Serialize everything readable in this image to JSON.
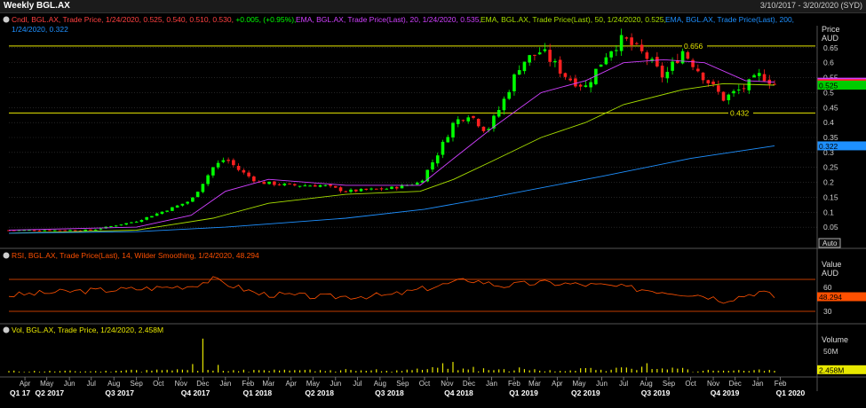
{
  "window": {
    "title": "Weekly BGL.AX",
    "date_range": "3/10/2017 - 3/20/2020 (SYD)"
  },
  "colors": {
    "up": "#00ff00",
    "down": "#ff2020",
    "ema20": "#d040ff",
    "ema50": "#a8e000",
    "ema200": "#1e90ff",
    "hline": "#e8e800",
    "rsi": "#ff5000",
    "vol": "#e8e800",
    "grid": "#3a3a3a",
    "text": "#d0d0d0"
  },
  "legend": {
    "candle_prefix": "Cndl, BGL.AX, Trade Price,  1/24/2020, 0.525, 0.540, 0.510, 0.530, ",
    "candle_change": "+0.005, (+0.95%),",
    "ema20": "EMA, BGL.AX, Trade Price(Last),  20,  1/24/2020, 0.535,",
    "ema50": "EMA, BGL.AX, Trade Price(Last),  50,  1/24/2020, 0.525,",
    "ema200a": "EMA, BGL.AX, Trade Price(Last),  200,",
    "ema200b": "1/24/2020, 0.322",
    "rsi": "RSI, BGL.AX, Trade Price(Last),  14,  Wilder Smoothing,  1/24/2020, 48.294",
    "vol": "Vol, BGL.AX, Trade Price,  1/24/2020,  2.458M"
  },
  "axes": {
    "price_title": "Price",
    "price_unit": "AUD",
    "value_title": "Value",
    "value_unit": "AUD",
    "volume_title": "Volume",
    "auto": "Auto"
  },
  "chart_data": {
    "type": "candlestick",
    "price": {
      "ylim": [
        0,
        0.7
      ],
      "ticks": [
        "0.05",
        "0.1",
        "0.15",
        "0.2",
        "0.25",
        "0.3",
        "0.35",
        "0.4",
        "0.45",
        "0.5",
        "0.55",
        "0.6",
        "0.65"
      ],
      "hlines": [
        {
          "value": 0.656,
          "label": "0.656"
        },
        {
          "value": 0.432,
          "label": "0.432"
        }
      ],
      "tags": [
        {
          "label": "0.535",
          "value": 0.535,
          "color": "#d040ff"
        },
        {
          "label": "0.530",
          "value": 0.53,
          "color": "#ff2020"
        },
        {
          "label": "0.525",
          "value": 0.525,
          "color": "#00cc00"
        },
        {
          "label": "0.322",
          "value": 0.322,
          "color": "#1e90ff"
        }
      ],
      "keypoints": [
        [
          "2017-03-10",
          0.04
        ],
        [
          "2017-07-01",
          0.04
        ],
        [
          "2017-09-01",
          0.07
        ],
        [
          "2017-10-15",
          0.11
        ],
        [
          "2017-11-15",
          0.14
        ],
        [
          "2017-12-15",
          0.25
        ],
        [
          "2018-01-01",
          0.28
        ],
        [
          "2018-01-20",
          0.24
        ],
        [
          "2018-02-15",
          0.2
        ],
        [
          "2018-04-01",
          0.19
        ],
        [
          "2018-05-15",
          0.19
        ],
        [
          "2018-06-15",
          0.17
        ],
        [
          "2018-08-15",
          0.18
        ],
        [
          "2018-09-25",
          0.2
        ],
        [
          "2018-10-20",
          0.3
        ],
        [
          "2018-11-10",
          0.4
        ],
        [
          "2018-12-01",
          0.43
        ],
        [
          "2018-12-25",
          0.37
        ],
        [
          "2019-01-15",
          0.46
        ],
        [
          "2019-02-10",
          0.6
        ],
        [
          "2019-03-10",
          0.64
        ],
        [
          "2019-04-15",
          0.55
        ],
        [
          "2019-05-10",
          0.52
        ],
        [
          "2019-06-10",
          0.64
        ],
        [
          "2019-07-01",
          0.68
        ],
        [
          "2019-08-01",
          0.62
        ],
        [
          "2019-08-25",
          0.55
        ],
        [
          "2019-09-20",
          0.64
        ],
        [
          "2019-10-20",
          0.55
        ],
        [
          "2019-11-15",
          0.48
        ],
        [
          "2019-12-15",
          0.52
        ],
        [
          "2020-01-05",
          0.56
        ],
        [
          "2020-01-24",
          0.53
        ]
      ]
    },
    "ema": [
      {
        "name": "EMA 20",
        "color": "#d040ff",
        "points": [
          [
            "2017-03-10",
            0.04
          ],
          [
            "2017-09-01",
            0.05
          ],
          [
            "2017-11-15",
            0.09
          ],
          [
            "2018-01-01",
            0.17
          ],
          [
            "2018-03-01",
            0.21
          ],
          [
            "2018-06-15",
            0.19
          ],
          [
            "2018-09-25",
            0.19
          ],
          [
            "2018-11-10",
            0.28
          ],
          [
            "2019-01-01",
            0.38
          ],
          [
            "2019-03-10",
            0.5
          ],
          [
            "2019-05-10",
            0.54
          ],
          [
            "2019-07-01",
            0.6
          ],
          [
            "2019-08-25",
            0.61
          ],
          [
            "2019-10-20",
            0.6
          ],
          [
            "2019-12-15",
            0.54
          ],
          [
            "2020-01-24",
            0.535
          ]
        ]
      },
      {
        "name": "EMA 50",
        "color": "#a8e000",
        "points": [
          [
            "2017-03-10",
            0.03
          ],
          [
            "2017-09-01",
            0.04
          ],
          [
            "2017-12-15",
            0.08
          ],
          [
            "2018-03-01",
            0.13
          ],
          [
            "2018-06-15",
            0.16
          ],
          [
            "2018-09-25",
            0.17
          ],
          [
            "2018-11-10",
            0.21
          ],
          [
            "2019-01-01",
            0.27
          ],
          [
            "2019-03-10",
            0.35
          ],
          [
            "2019-05-10",
            0.4
          ],
          [
            "2019-07-01",
            0.46
          ],
          [
            "2019-09-20",
            0.51
          ],
          [
            "2019-11-15",
            0.53
          ],
          [
            "2020-01-24",
            0.525
          ]
        ]
      },
      {
        "name": "EMA 200",
        "color": "#1e90ff",
        "points": [
          [
            "2017-03-10",
            0.03
          ],
          [
            "2017-09-01",
            0.035
          ],
          [
            "2018-01-01",
            0.05
          ],
          [
            "2018-06-15",
            0.08
          ],
          [
            "2018-10-01",
            0.11
          ],
          [
            "2019-01-01",
            0.15
          ],
          [
            "2019-06-01",
            0.22
          ],
          [
            "2019-10-01",
            0.28
          ],
          [
            "2020-01-24",
            0.322
          ]
        ]
      }
    ],
    "rsi": {
      "levels": [
        70,
        30
      ],
      "ticks": [
        "60",
        "30"
      ],
      "last": "48.294",
      "ylim": [
        20,
        90
      ],
      "keypoints": [
        [
          "2017-03-10",
          50
        ],
        [
          "2017-06-01",
          55
        ],
        [
          "2017-09-01",
          58
        ],
        [
          "2017-11-15",
          62
        ],
        [
          "2017-12-15",
          70
        ],
        [
          "2018-02-15",
          52
        ],
        [
          "2018-05-15",
          48
        ],
        [
          "2018-08-15",
          50
        ],
        [
          "2018-10-20",
          62
        ],
        [
          "2018-12-01",
          70
        ],
        [
          "2019-01-15",
          62
        ],
        [
          "2019-03-10",
          66
        ],
        [
          "2019-06-10",
          62
        ],
        [
          "2019-08-25",
          55
        ],
        [
          "2019-10-20",
          50
        ],
        [
          "2019-11-15",
          44
        ],
        [
          "2020-01-05",
          55
        ],
        [
          "2020-01-24",
          48.294
        ]
      ]
    },
    "volume": {
      "ticks": [
        "50M"
      ],
      "last": "2.458M",
      "ylim": [
        0,
        90
      ],
      "spikes": [
        [
          "2017-12-01",
          80
        ],
        [
          "2017-11-20",
          20
        ],
        [
          "2017-12-22",
          18
        ],
        [
          "2018-10-25",
          22
        ],
        [
          "2018-11-10",
          25
        ],
        [
          "2019-08-01",
          22
        ],
        [
          "2019-02-10",
          12
        ]
      ]
    },
    "x_axis": {
      "months": [
        [
          "2017-04-01",
          "Apr"
        ],
        [
          "2017-05-01",
          "May"
        ],
        [
          "2017-06-01",
          "Jun"
        ],
        [
          "2017-07-01",
          "Jul"
        ],
        [
          "2017-08-01",
          "Aug"
        ],
        [
          "2017-09-01",
          "Sep"
        ],
        [
          "2017-10-01",
          "Oct"
        ],
        [
          "2017-11-01",
          "Nov"
        ],
        [
          "2017-12-01",
          "Dec"
        ],
        [
          "2018-01-01",
          "Jan"
        ],
        [
          "2018-02-01",
          "Feb"
        ],
        [
          "2018-03-01",
          "Mar"
        ],
        [
          "2018-04-01",
          "Apr"
        ],
        [
          "2018-05-01",
          "May"
        ],
        [
          "2018-06-01",
          "Jun"
        ],
        [
          "2018-07-01",
          "Jul"
        ],
        [
          "2018-08-01",
          "Aug"
        ],
        [
          "2018-09-01",
          "Sep"
        ],
        [
          "2018-10-01",
          "Oct"
        ],
        [
          "2018-11-01",
          "Nov"
        ],
        [
          "2018-12-01",
          "Dec"
        ],
        [
          "2019-01-01",
          "Jan"
        ],
        [
          "2019-02-01",
          "Feb"
        ],
        [
          "2019-03-01",
          "Mar"
        ],
        [
          "2019-04-01",
          "Apr"
        ],
        [
          "2019-05-01",
          "May"
        ],
        [
          "2019-06-01",
          "Jun"
        ],
        [
          "2019-07-01",
          "Jul"
        ],
        [
          "2019-08-01",
          "Aug"
        ],
        [
          "2019-09-01",
          "Sep"
        ],
        [
          "2019-10-01",
          "Oct"
        ],
        [
          "2019-11-01",
          "Nov"
        ],
        [
          "2019-12-01",
          "Dec"
        ],
        [
          "2020-01-01",
          "Jan"
        ],
        [
          "2020-02-01",
          "Feb"
        ]
      ],
      "quarters": [
        [
          "2017-03-10",
          "Q1 17"
        ],
        [
          "2017-04-15",
          "Q2 2017"
        ],
        [
          "2017-07-20",
          "Q3 2017"
        ],
        [
          "2017-11-01",
          "Q4 2017"
        ],
        [
          "2018-01-25",
          "Q1 2018"
        ],
        [
          "2018-04-20",
          "Q2 2018"
        ],
        [
          "2018-07-25",
          "Q3 2018"
        ],
        [
          "2018-10-28",
          "Q4 2018"
        ],
        [
          "2019-01-25",
          "Q1 2019"
        ],
        [
          "2019-04-20",
          "Q2 2019"
        ],
        [
          "2019-07-25",
          "Q3 2019"
        ],
        [
          "2019-10-28",
          "Q4 2019"
        ],
        [
          "2020-01-26",
          "Q1 2020"
        ]
      ],
      "start": "2017-03-10",
      "end": "2020-03-20",
      "data_end": "2020-01-24"
    }
  }
}
